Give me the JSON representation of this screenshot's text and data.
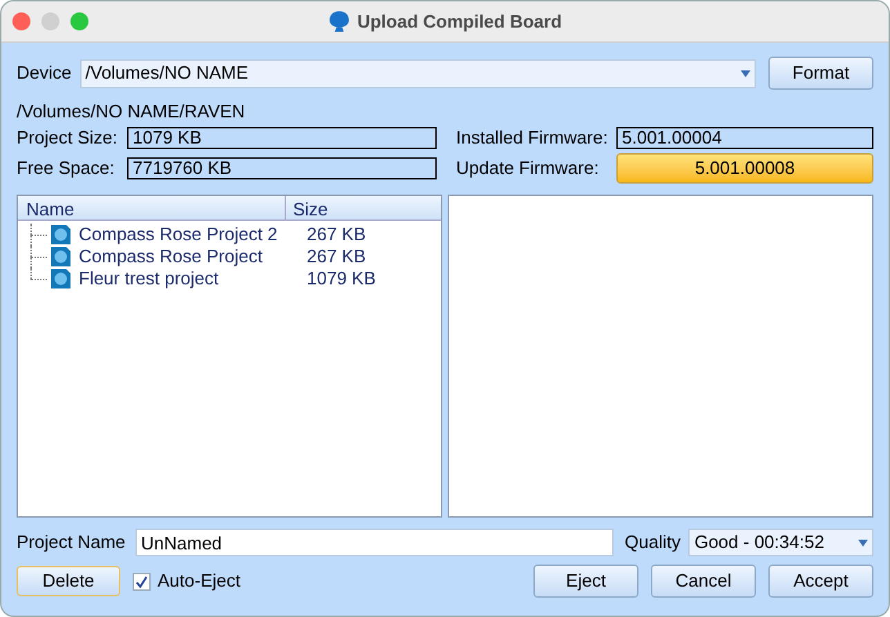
{
  "window": {
    "title": "Upload Compiled Board"
  },
  "device": {
    "label": "Device",
    "value": "/Volumes/NO NAME"
  },
  "format_button": "Format",
  "path": "/Volumes/NO NAME/RAVEN",
  "project_size": {
    "label": "Project Size:",
    "value": "1079 KB"
  },
  "free_space": {
    "label": "Free Space:",
    "value": "7719760 KB"
  },
  "installed_firmware": {
    "label": "Installed Firmware:",
    "value": "5.001.00004"
  },
  "update_firmware": {
    "label": "Update Firmware:",
    "button": "5.001.00008"
  },
  "table": {
    "columns": [
      "Name",
      "Size"
    ],
    "rows": [
      {
        "name": "Compass Rose Project 2",
        "size": "267 KB",
        "selected": false
      },
      {
        "name": "Compass Rose Project",
        "size": "267 KB",
        "selected": false
      },
      {
        "name": "Fleur trest project",
        "size": "1079 KB",
        "selected": false
      }
    ]
  },
  "project_name": {
    "label": "Project Name",
    "value": "UnNamed"
  },
  "quality": {
    "label": "Quality",
    "value": "Good - 00:34:52"
  },
  "delete_button": "Delete",
  "auto_eject": {
    "label": "Auto-Eject",
    "checked": true
  },
  "buttons": [
    "Eject",
    "Cancel",
    "Accept"
  ]
}
